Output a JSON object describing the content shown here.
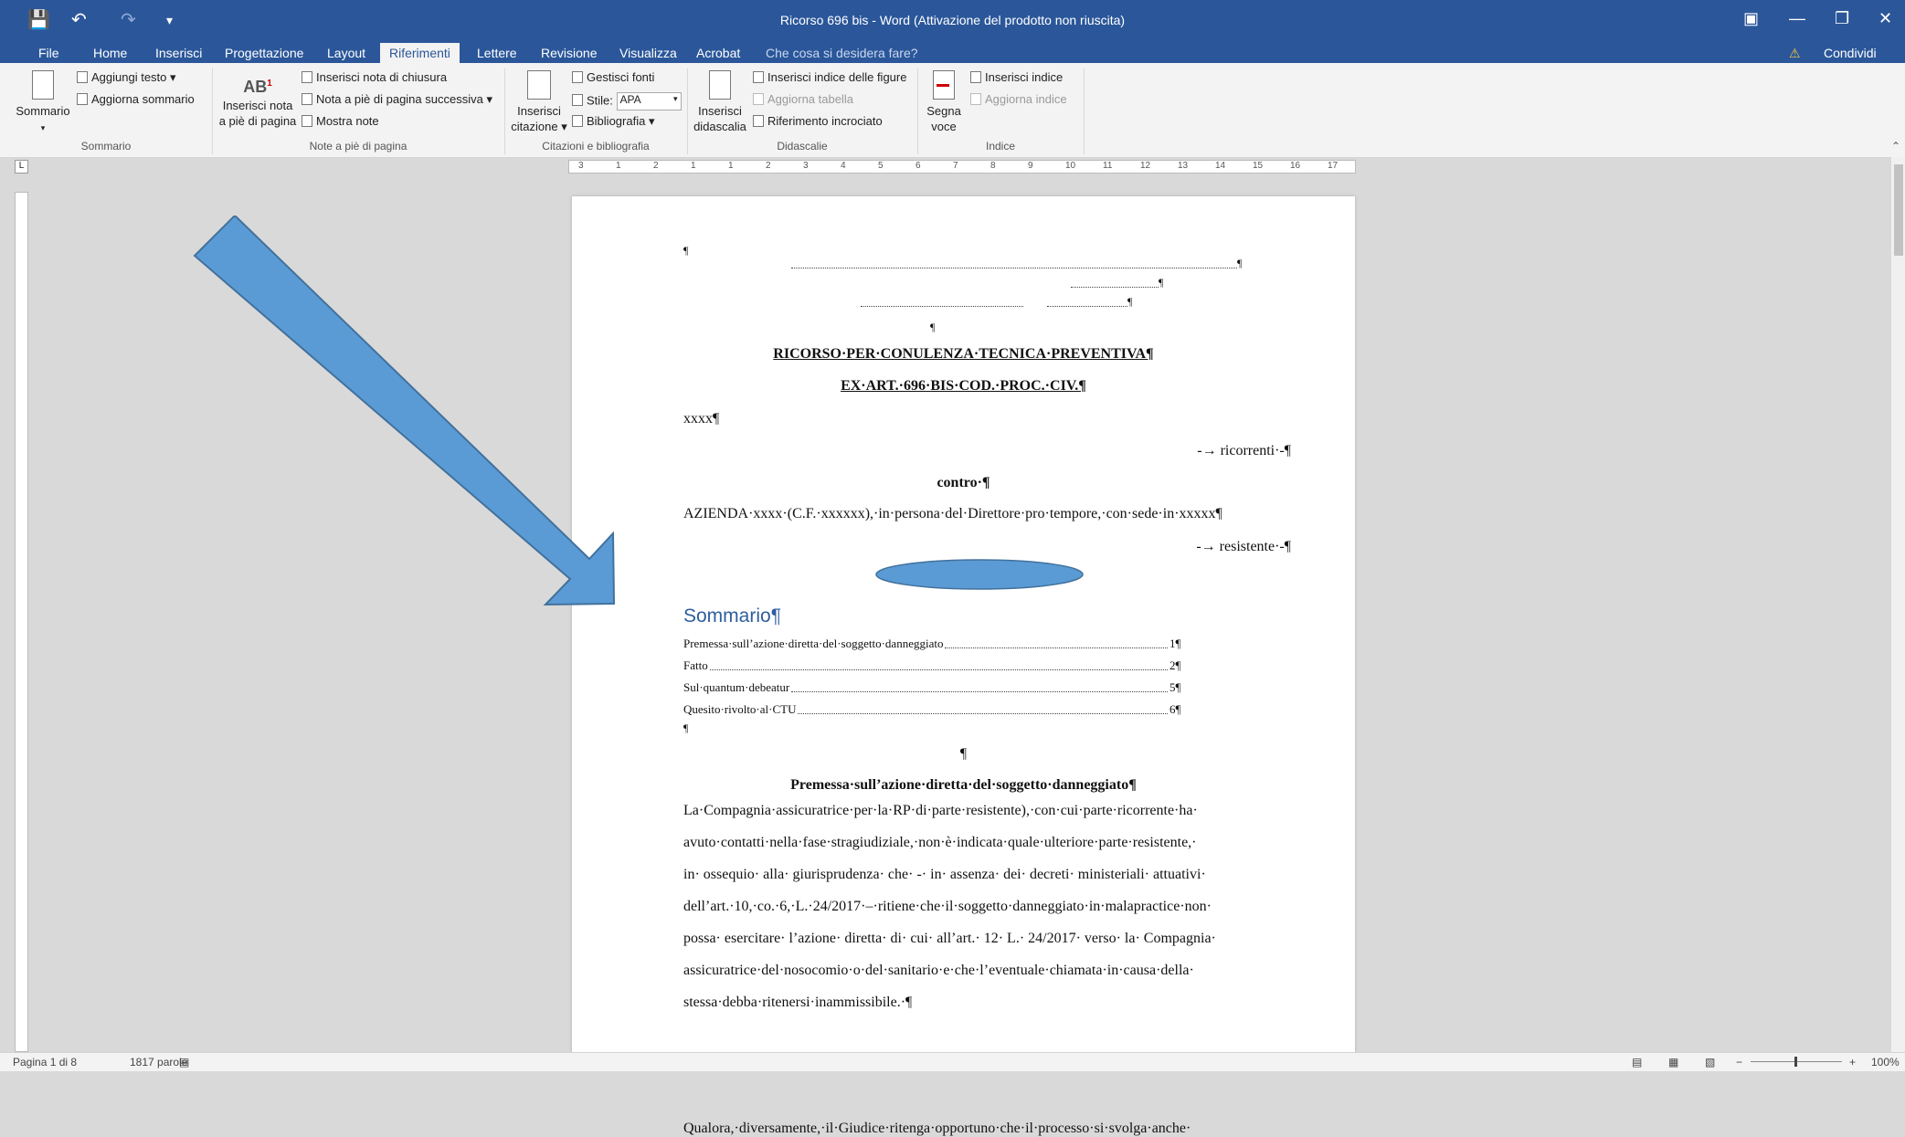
{
  "window": {
    "title": "Ricorso 696 bis - Word (Attivazione del prodotto non riuscita)",
    "share_label": "Condividi",
    "tell_me": "Che cosa si desidera fare?"
  },
  "tabs": [
    "File",
    "Home",
    "Inserisci",
    "Progettazione",
    "Layout",
    "Riferimenti",
    "Lettere",
    "Revisione",
    "Visualizza",
    "Acrobat"
  ],
  "active_tab": "Riferimenti",
  "ribbon": {
    "sommario": {
      "big": "Sommario",
      "add_text": "Aggiungi testo",
      "update": "Aggiorna sommario",
      "group": "Sommario"
    },
    "note": {
      "big_line1": "Inserisci nota",
      "big_line2": "a piè di pagina",
      "endnote": "Inserisci nota di chiusura",
      "next": "Nota a piè di pagina successiva",
      "show": "Mostra note",
      "group": "Note a piè di pagina"
    },
    "citazioni": {
      "big_line1": "Inserisci",
      "big_line2": "citazione",
      "manage": "Gestisci fonti",
      "style_label": "Stile:",
      "style_value": "APA",
      "biblio": "Bibliografia",
      "group": "Citazioni e bibliografia"
    },
    "didascalie": {
      "big_line1": "Inserisci",
      "big_line2": "didascalia",
      "figures": "Inserisci indice delle figure",
      "update_table": "Aggiorna tabella",
      "crossref": "Riferimento incrociato",
      "group": "Didascalie"
    },
    "indice": {
      "big_line1": "Segna",
      "big_line2": "voce",
      "insert": "Inserisci indice",
      "update": "Aggiorna indice",
      "group": "Indice"
    }
  },
  "ruler": [
    "3",
    "1",
    "2",
    "1",
    "1",
    "2",
    "3",
    "4",
    "5",
    "6",
    "7",
    "8",
    "9",
    "10",
    "11",
    "12",
    "13",
    "14",
    "15",
    "16",
    "17"
  ],
  "document": {
    "title1": "RICORSO·PER·CONULENZA·TECNICA·PREVENTIVA¶",
    "title2": "EX·ART.·696·BIS·COD.·PROC.·CIV.¶",
    "xxxx": "xxxx¶",
    "ricorrenti": "-→ ricorrenti·-¶",
    "contro": "contro·¶",
    "azienda": "AZIENDA·xxxx·(C.F.·xxxxxx),·in·persona·del·Direttore·pro·tempore,·con·sede·in·xxxxx¶",
    "resistente": "-→ resistente·-¶",
    "sommario": "Sommario¶",
    "toc": [
      {
        "label": "Premessa·sull’azione·diretta·del·soggetto·danneggiato",
        "page": "1¶"
      },
      {
        "label": "Fatto",
        "page": "2¶"
      },
      {
        "label": "Sul·quantum·debeatur",
        "page": "5¶"
      },
      {
        "label": "Quesito·rivolto·al·CTU",
        "page": "6¶"
      }
    ],
    "pilcrow": "¶",
    "section_title": "Premessa·sull’azione·diretta·del·soggetto·danneggiato¶",
    "para1": [
      "La·Compagnia·assicuratrice·per·la·RP·di·parte·resistente),·con·cui·parte·ricorrente·ha·",
      "avuto·contatti·nella·fase·stragiudiziale,·non·è·indicata·quale·ulteriore·parte·resistente,·",
      "in· ossequio· alla· giurisprudenza· che· -· in· assenza· dei· decreti· ministeriali· attuativi·",
      "dell’art.·10,·co.·6,·L.·24/2017·–·ritiene·che·il·soggetto·danneggiato·in·malapractice·non·",
      "possa· esercitare· l’azione· diretta· di· cui· all’art.· 12· L.· 24/2017· verso· la· Compagnia·",
      "assicuratrice·del·nosocomio·o·del·sanitario·e·che·l’eventuale·chiamata·in·causa·della·",
      "stessa·debba·ritenersi·inammissibile.·¶"
    ],
    "para2": "Qualora,·diversamente,·il·Giudice·ritenga·opportuno·che·il·processo·si·svolga·anche·"
  },
  "status": {
    "page": "Pagina 1 di 8",
    "words": "1817 parole",
    "zoom": "100%"
  },
  "colors": {
    "accent": "#2b579a",
    "arrow": "#5b9bd5",
    "heading": "#2e5e9e"
  }
}
